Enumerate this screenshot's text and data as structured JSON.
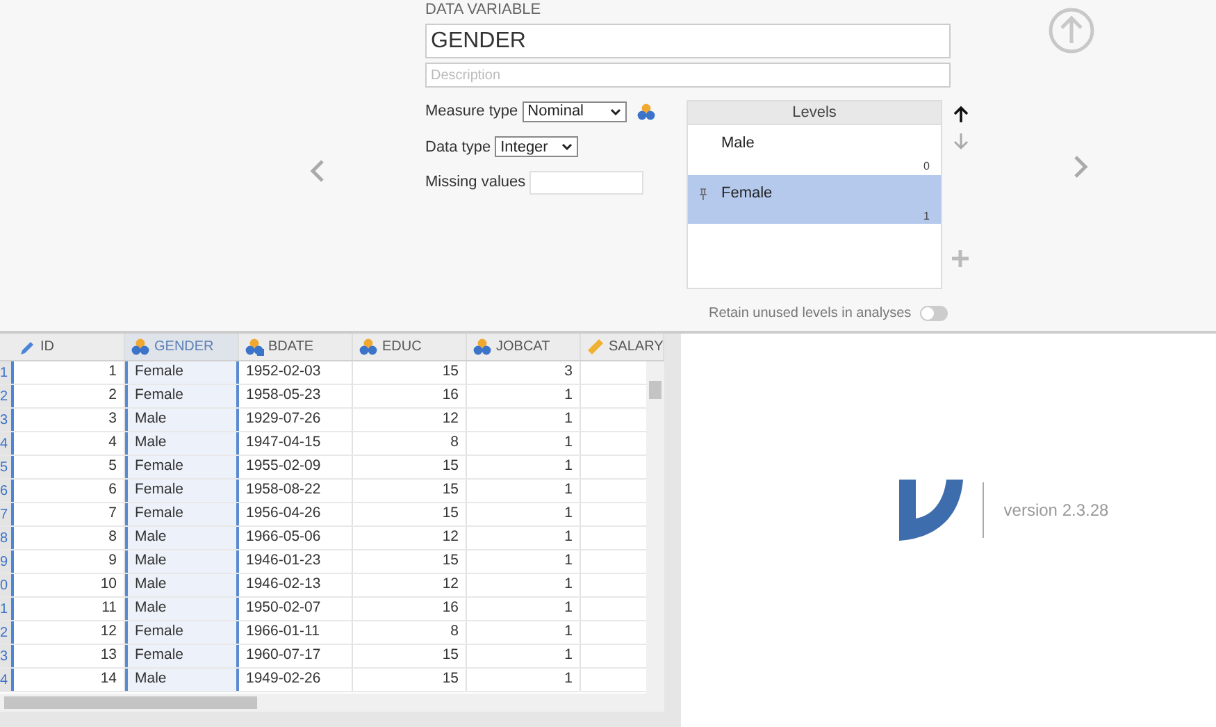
{
  "variable_editor": {
    "heading": "DATA VARIABLE",
    "name": "GENDER",
    "description": {
      "placeholder": "Description"
    },
    "measure_type": {
      "label": "Measure type",
      "value": "Nominal"
    },
    "data_type": {
      "label": "Data type",
      "value": "Integer"
    },
    "missing_values": {
      "label": "Missing values"
    },
    "levels": {
      "title": "Levels",
      "items": [
        {
          "label": "Male",
          "value": "0",
          "selected": false,
          "pinned": false
        },
        {
          "label": "Female",
          "value": "1",
          "selected": true,
          "pinned": true
        }
      ]
    },
    "retain_unused": {
      "label": "Retain unused levels in analyses",
      "on": false
    }
  },
  "table": {
    "columns": [
      {
        "name": "ID",
        "kind": "id",
        "selected": false
      },
      {
        "name": "GENDER",
        "kind": "nominal",
        "selected": true
      },
      {
        "name": "BDATE",
        "kind": "nominal_text",
        "selected": false
      },
      {
        "name": "EDUC",
        "kind": "nominal",
        "selected": false
      },
      {
        "name": "JOBCAT",
        "kind": "nominal",
        "selected": false
      },
      {
        "name": "SALARY",
        "kind": "continuous",
        "selected": false
      }
    ],
    "rows": [
      {
        "row_label": "1",
        "cells": [
          "1",
          "Female",
          "1952-02-03",
          "15",
          "3"
        ]
      },
      {
        "row_label": "2",
        "cells": [
          "2",
          "Female",
          "1958-05-23",
          "16",
          "1"
        ]
      },
      {
        "row_label": "3",
        "cells": [
          "3",
          "Male",
          "1929-07-26",
          "12",
          "1"
        ]
      },
      {
        "row_label": "4",
        "cells": [
          "4",
          "Male",
          "1947-04-15",
          "8",
          "1"
        ]
      },
      {
        "row_label": "5",
        "cells": [
          "5",
          "Female",
          "1955-02-09",
          "15",
          "1"
        ]
      },
      {
        "row_label": "6",
        "cells": [
          "6",
          "Female",
          "1958-08-22",
          "15",
          "1"
        ]
      },
      {
        "row_label": "7",
        "cells": [
          "7",
          "Female",
          "1956-04-26",
          "15",
          "1"
        ]
      },
      {
        "row_label": "8",
        "cells": [
          "8",
          "Male",
          "1966-05-06",
          "12",
          "1"
        ]
      },
      {
        "row_label": "9",
        "cells": [
          "9",
          "Male",
          "1946-01-23",
          "15",
          "1"
        ]
      },
      {
        "row_label": "0",
        "cells": [
          "10",
          "Male",
          "1946-02-13",
          "12",
          "1"
        ]
      },
      {
        "row_label": "1",
        "cells": [
          "11",
          "Male",
          "1950-02-07",
          "16",
          "1"
        ]
      },
      {
        "row_label": "2",
        "cells": [
          "12",
          "Female",
          "1966-01-11",
          "8",
          "1"
        ]
      },
      {
        "row_label": "3",
        "cells": [
          "13",
          "Female",
          "1960-07-17",
          "15",
          "1"
        ]
      },
      {
        "row_label": "4",
        "cells": [
          "14",
          "Male",
          "1949-02-26",
          "15",
          "1"
        ]
      }
    ]
  },
  "welcome": {
    "version": "version 2.3.28"
  }
}
